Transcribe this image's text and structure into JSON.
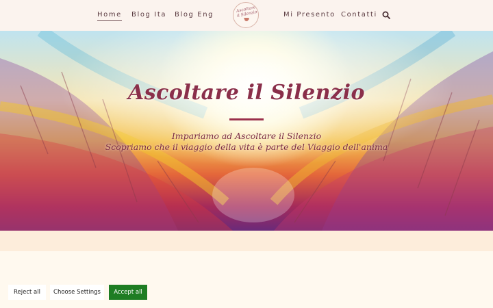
{
  "nav": {
    "items": [
      {
        "label": "Home",
        "active": true
      },
      {
        "label": "Blog Ita",
        "active": false
      },
      {
        "label": "Blog Eng",
        "active": false
      },
      {
        "label": "Mi Presento",
        "active": false
      },
      {
        "label": "Contatti",
        "active": false
      }
    ],
    "logo_text": "Ascoltare il Silenzio",
    "search_icon": "search-icon"
  },
  "hero": {
    "title": "Ascoltare il Silenzio",
    "subtitle_line1": "Impariamo ad Ascoltare il Silenzio",
    "subtitle_line2": "Scopriamo che il viaggio della vita è parte del Viaggio dell'anima",
    "accent_color": "#9a2f4b"
  },
  "cookie_banner": {
    "reject_label": "Reject all",
    "settings_label": "Choose Settings",
    "accept_label": "Accept all",
    "accept_color": "#1e7d23"
  }
}
